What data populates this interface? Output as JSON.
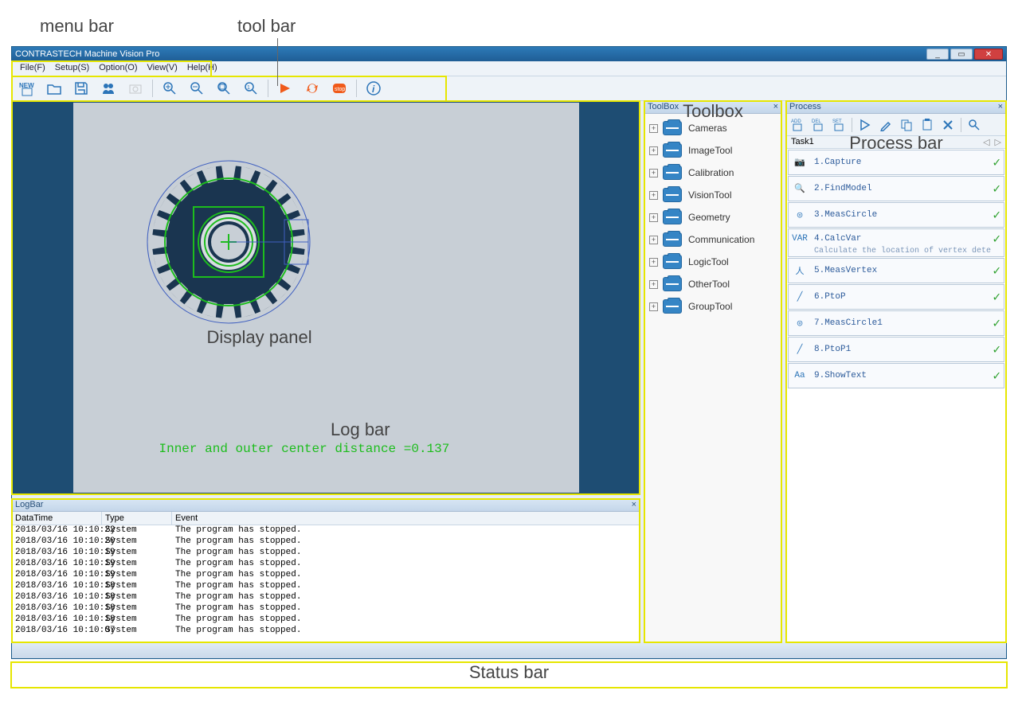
{
  "annotations": {
    "menubar": "menu bar",
    "toolbar": "tool bar",
    "display": "Display panel",
    "toolbox": "Toolbox",
    "process": "Process bar",
    "logbar": "Log bar",
    "statusbar": "Status bar"
  },
  "title": "CONTRASTECH Machine Vision Pro",
  "menus": [
    "File(F)",
    "Setup(S)",
    "Option(O)",
    "View(V)",
    "Help(H)"
  ],
  "display_text": "Inner and outer center distance =0.137",
  "toolbox_title": "ToolBox",
  "toolbox_items": [
    "Cameras",
    "ImageTool",
    "Calibration",
    "VisionTool",
    "Geometry",
    "Communication",
    "LogicTool",
    "OtherTool",
    "GroupTool"
  ],
  "process_title": "Process",
  "process_tab": "Task1",
  "process_items": [
    {
      "n": "1.Capture",
      "sub": ""
    },
    {
      "n": "2.FindModel",
      "sub": ""
    },
    {
      "n": "3.MeasCircle",
      "sub": ""
    },
    {
      "n": "4.CalcVar",
      "sub": "Calculate the location of vertex dete"
    },
    {
      "n": "5.MeasVertex",
      "sub": ""
    },
    {
      "n": "6.PtoP",
      "sub": ""
    },
    {
      "n": "7.MeasCircle1",
      "sub": ""
    },
    {
      "n": "8.PtoP1",
      "sub": ""
    },
    {
      "n": "9.ShowText",
      "sub": ""
    }
  ],
  "logbar_title": "LogBar",
  "log_headers": [
    "DataTime",
    "Type",
    "Event"
  ],
  "log_rows": [
    [
      "2018/03/16 10:10:22",
      "System",
      "The program has stopped."
    ],
    [
      "2018/03/16 10:10:20",
      "System",
      "The program has stopped."
    ],
    [
      "2018/03/16 10:10:19",
      "System",
      "The program has stopped."
    ],
    [
      "2018/03/16 10:10:19",
      "System",
      "The program has stopped."
    ],
    [
      "2018/03/16 10:10:19",
      "System",
      "The program has stopped."
    ],
    [
      "2018/03/16 10:10:18",
      "System",
      "The program has stopped."
    ],
    [
      "2018/03/16 10:10:18",
      "System",
      "The program has stopped."
    ],
    [
      "2018/03/16 10:10:18",
      "System",
      "The program has stopped."
    ],
    [
      "2018/03/16 10:10:18",
      "System",
      "The program has stopped."
    ],
    [
      "2018/03/16 10:10:07",
      "System",
      "The program has stopped."
    ]
  ]
}
